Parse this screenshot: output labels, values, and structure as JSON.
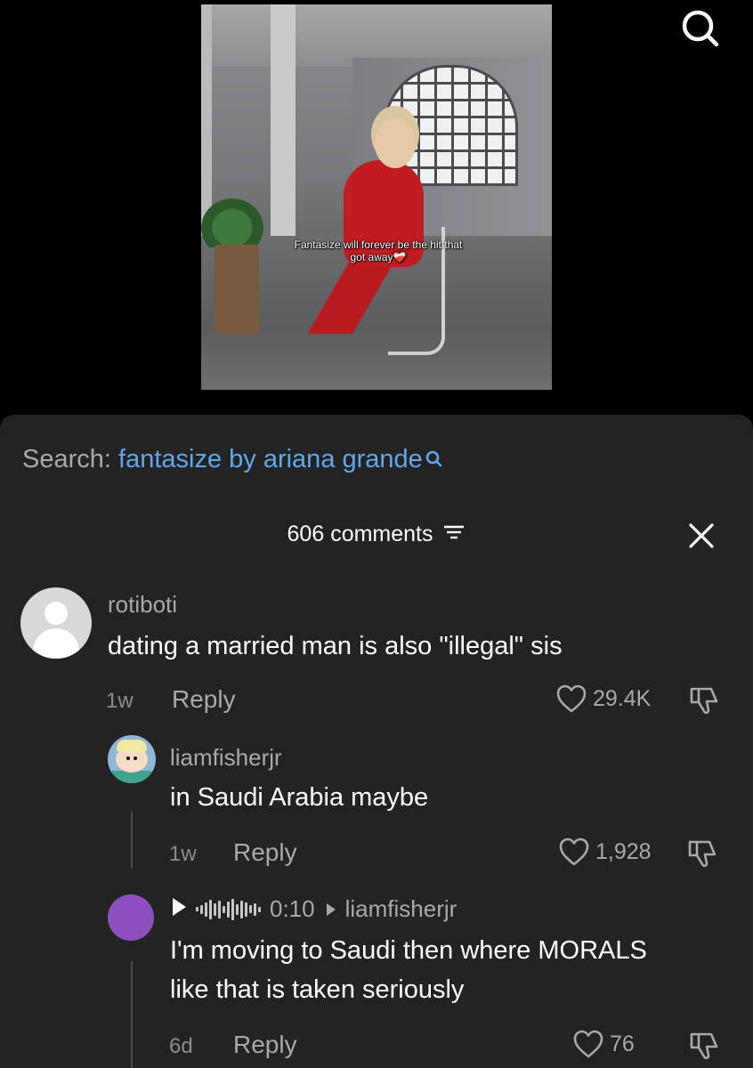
{
  "video": {
    "caption_line1": "Fantasize will forever be the hit that",
    "caption_line2": "got away",
    "caption_emoji": "❤️‍🩹"
  },
  "top_bar": {
    "search_icon": "search-icon"
  },
  "search_suggestion": {
    "label": "Search:",
    "query": "fantasize by ariana grande",
    "icon": "search-icon",
    "label_color": "#a9a9a9",
    "query_color": "#5fa8ea"
  },
  "comments_header": {
    "count_label": "606 comments",
    "filter_icon": "filter-icon",
    "close_icon": "close-icon"
  },
  "comments": [
    {
      "username": "rotiboti",
      "text": "dating a married man is also \"illegal\" sis",
      "age": "1w",
      "reply_label": "Reply",
      "likes": "29.4K",
      "avatar": "default-avatar"
    },
    {
      "username": "liamfisherjr",
      "text": "in Saudi Arabia maybe",
      "age": "1w",
      "reply_label": "Reply",
      "likes": "1,928",
      "avatar": "butters-avatar"
    },
    {
      "voice_duration": "0:10",
      "reply_to": "liamfisherjr",
      "text_line1": "I'm moving to Saudi then where MORALS",
      "text_line2": "like that is taken seriously",
      "age": "6d",
      "reply_label": "Reply",
      "likes": "76",
      "avatar": "purple-avatar"
    }
  ],
  "colors": {
    "background": "#000000",
    "panel": "#232323",
    "link_blue": "#5fa8ea",
    "muted_text": "#a9a9a9",
    "purple_avatar": "#8e4fc1"
  }
}
